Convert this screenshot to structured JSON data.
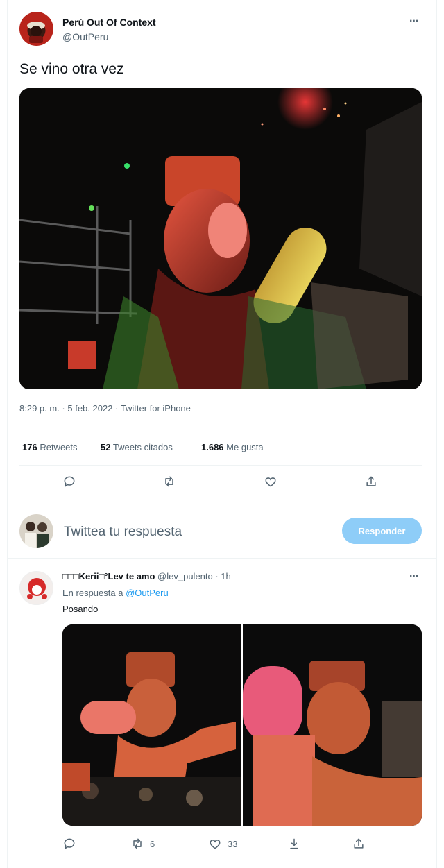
{
  "tweet": {
    "author_name": "Perú Out Of Context",
    "handle": "@OutPeru",
    "more_glyph": "···",
    "text": "Se vino otra vez",
    "meta": "8:29 p. m. · 5 feb. 2022 · Twitter for iPhone",
    "stats": {
      "retweets_count": "176",
      "retweets_label": "Retweets",
      "quotes_count": "52",
      "quotes_label": "Tweets citados",
      "likes_count": "1.686",
      "likes_label": "Me gusta"
    },
    "actions": [
      "reply-icon",
      "retweet-icon",
      "like-icon",
      "share-icon"
    ]
  },
  "compose": {
    "placeholder": "Twittea tu respuesta",
    "button_label": "Responder"
  },
  "reply": {
    "author_name": "□□□Kerii□°Lev te amo",
    "handle_time": "@lev_pulento · 1h",
    "more_glyph": "···",
    "in_reply_prefix": "En respuesta a",
    "in_reply_handle": "@OutPeru",
    "text": "Posando",
    "actions": {
      "retweet_count": "6",
      "like_count": "33"
    }
  },
  "colors": {
    "accent": "#1d9bf0",
    "reply_button": "#8ecdf8",
    "muted": "#536471",
    "divider": "#eff3f4"
  }
}
